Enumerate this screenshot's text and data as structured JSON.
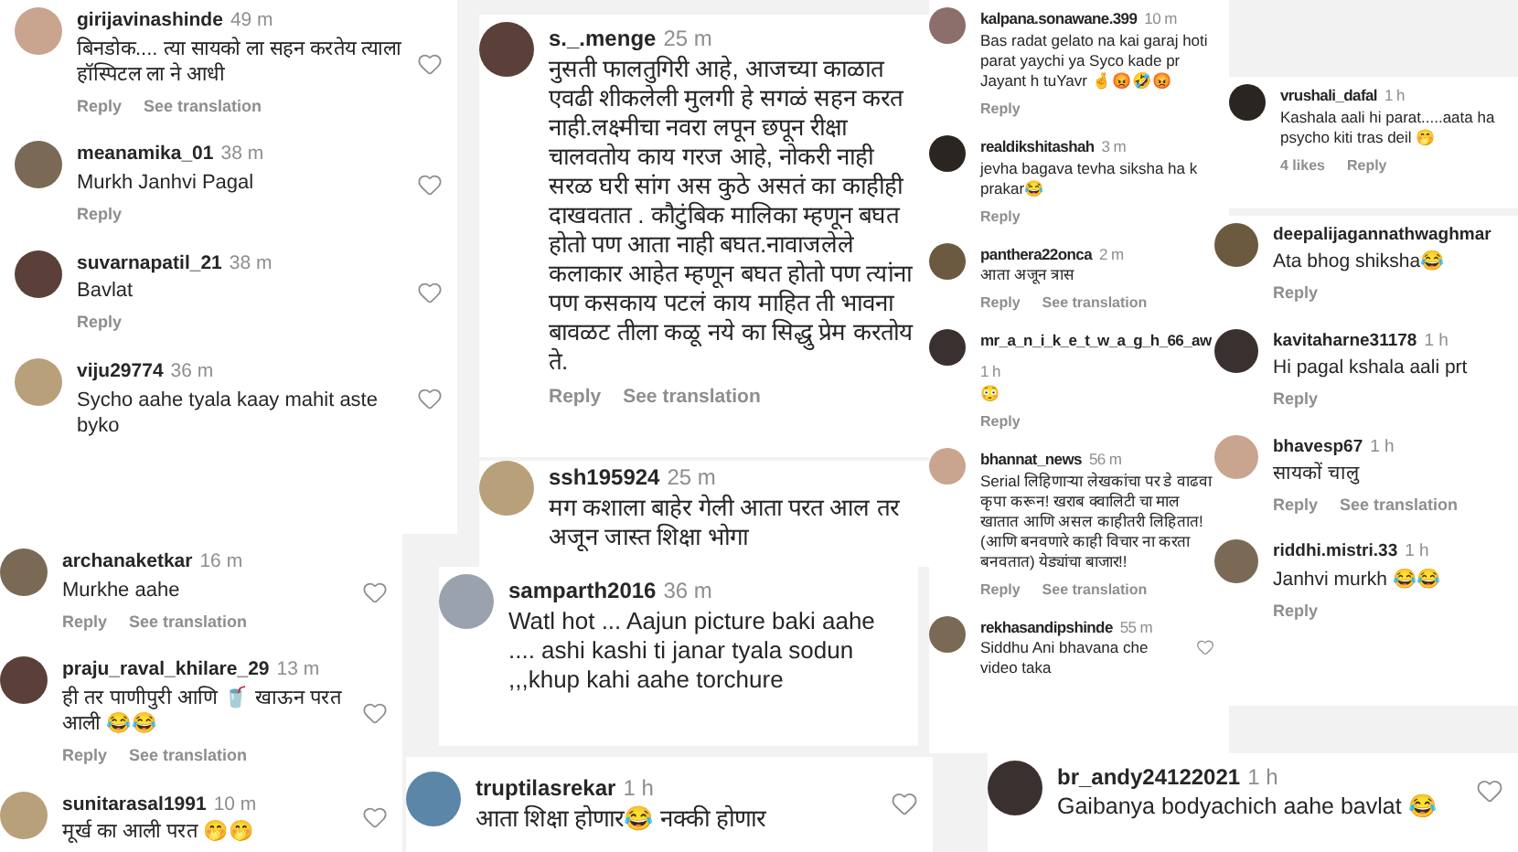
{
  "clippings": [
    {
      "comments": [
        {
          "user": "girijavinashinde",
          "time": "49 m",
          "text": "बिनडोक.... त्या सायको ला सहन करतेय त्याला हॉस्पिटल ला ने आधी",
          "actions": [
            "Reply",
            "See translation"
          ],
          "like_button": true
        },
        {
          "user": "meanamika_01",
          "time": "38 m",
          "text": "Murkh Janhvi Pagal",
          "actions": [
            "Reply"
          ],
          "like_button": true
        },
        {
          "user": "suvarnapatil_21",
          "time": "38 m",
          "text": "Bavlat",
          "actions": [
            "Reply"
          ],
          "like_button": true
        },
        {
          "user": "viju29774",
          "time": "36 m",
          "text": "Sycho aahe tyala kaay mahit aste byko",
          "like_button": true
        }
      ]
    },
    {
      "comments": [
        {
          "user": "archanaketkar",
          "time": "16 m",
          "text": "Murkhe aahe",
          "actions": [
            "Reply",
            "See translation"
          ],
          "like_button": true
        },
        {
          "user": "praju_raval_khilare_29",
          "time": "13 m",
          "text": "ही तर पाणीपुरी आणि 🥤 खाऊन परत आली 😂😂",
          "actions": [
            "Reply",
            "See translation"
          ],
          "like_button": true
        },
        {
          "user": "sunitarasal1991",
          "time": "10 m",
          "text": "मूर्ख का आली परत 🤭🤭",
          "like_button": true
        }
      ]
    },
    {
      "comments": [
        {
          "user": "s._.menge",
          "time": "25 m",
          "text": "नुसती फालतुगिरी आहे, आजच्या काळात एवढी शीकलेली मुलगी हे सगळं सहन करत नाही.लक्ष्मीचा नवरा लपून छपून रीक्षा चालवतोय काय गरज आहे, नोकरी नाही सरळ घरी सांग अस कुठे असतं का काहीही दाखवतात . कौटुंबिक मालिका म्हणून बघत होतो पण आता नाही बघत.नावाजलेले कलाकार आहेत म्हणून बघत होतो पण त्यांना पण कसकाय पटलं काय माहित ती भावना बावळट तीला कळू नये का सिद्धु प्रेम करतोय ते.",
          "actions": [
            "Reply",
            "See translation"
          ],
          "like_button": false
        }
      ]
    },
    {
      "comments": [
        {
          "user": "ssh195924",
          "time": "25 m",
          "text": "मग कशाला बाहेर गेली आता परत आल तर अजून जास्त शिक्षा भोगा",
          "like_button": false
        }
      ]
    },
    {
      "comments": [
        {
          "user": "samparth2016",
          "time": "36 m",
          "text": "Watl hot ... Aajun picture baki aahe .... ashi kashi ti janar tyala sodun ,,,khup kahi aahe torchure",
          "like_button": false
        }
      ]
    },
    {
      "comments": [
        {
          "user": "truptilasrekar",
          "time": "1 h",
          "text": "आता शिक्षा होणार😂 नक्की होणार",
          "like_button": true
        }
      ]
    },
    {
      "comments": [
        {
          "user": "kalpana.sonawane.399",
          "time": "10 m",
          "text": "Bas radat gelato na kai garaj hoti parat yaychi ya Syco kade pr Jayant h tuYavr 🤞😡🤣😡",
          "actions": [
            "Reply"
          ],
          "like_button": false
        },
        {
          "user": "realdikshitashah",
          "time": "3 m",
          "text": "jevha bagava tevha siksha ha k prakar😂",
          "actions": [
            "Reply"
          ],
          "like_button": false
        },
        {
          "user": "panthera22onca",
          "time": "2 m",
          "text": "आता अजून त्रास",
          "actions": [
            "Reply",
            "See translation"
          ],
          "like_button": false
        },
        {
          "user": "mr_a_n_i_k_e_t_w_a_g_h_66_aw",
          "time": "1 h",
          "text": "😳",
          "actions": [
            "Reply"
          ],
          "like_button": false
        },
        {
          "user": "bhannat_news",
          "time": "56 m",
          "text": "Serial लिहिणाऱ्या लेखकांचा पर डे वाढवा कृपा करून! खराब क्वालिटी चा माल खातात आणि असल काहीतरी लिहितात! (आणि बनवणारे काही विचार ना करता बनवतात) येड्यांचा बाजार!!",
          "actions": [
            "Reply",
            "See translation"
          ],
          "like_button": false
        },
        {
          "user": "rekhasandipshinde",
          "time": "55 m",
          "text": "Siddhu Ani bhavana che video taka",
          "like_button": true
        }
      ]
    },
    {
      "comments": [
        {
          "user": "vrushali_dafal",
          "time": "1 h",
          "text": "Kashala aali hi parat.....aata ha psycho kiti tras deil 🤭",
          "actions": [
            "4 likes",
            "Reply"
          ],
          "like_button": false
        }
      ]
    },
    {
      "comments": [
        {
          "user": "deepalijagannathwaghmar",
          "text": "Ata bhog shiksha😂",
          "actions": [
            "Reply"
          ],
          "like_button": false
        },
        {
          "user": "kavitaharne31178",
          "time": "1 h",
          "text": "Hi pagal kshala aali prt",
          "actions": [
            "Reply"
          ],
          "like_button": false
        },
        {
          "user": "bhavesp67",
          "time": "1 h",
          "text": "सायकों चालु",
          "actions": [
            "Reply",
            "See translation"
          ],
          "like_button": false
        },
        {
          "user": "riddhi.mistri.33",
          "time": "1 h",
          "text": "Janhvi murkh 😂😂",
          "actions": [
            "Reply"
          ],
          "like_button": false
        }
      ]
    },
    {
      "comments": [
        {
          "user": "br_andy24122021",
          "time": "1 h",
          "text": "Gaibanya bodyachich aahe bavlat 😂",
          "like_button": true
        }
      ]
    }
  ]
}
